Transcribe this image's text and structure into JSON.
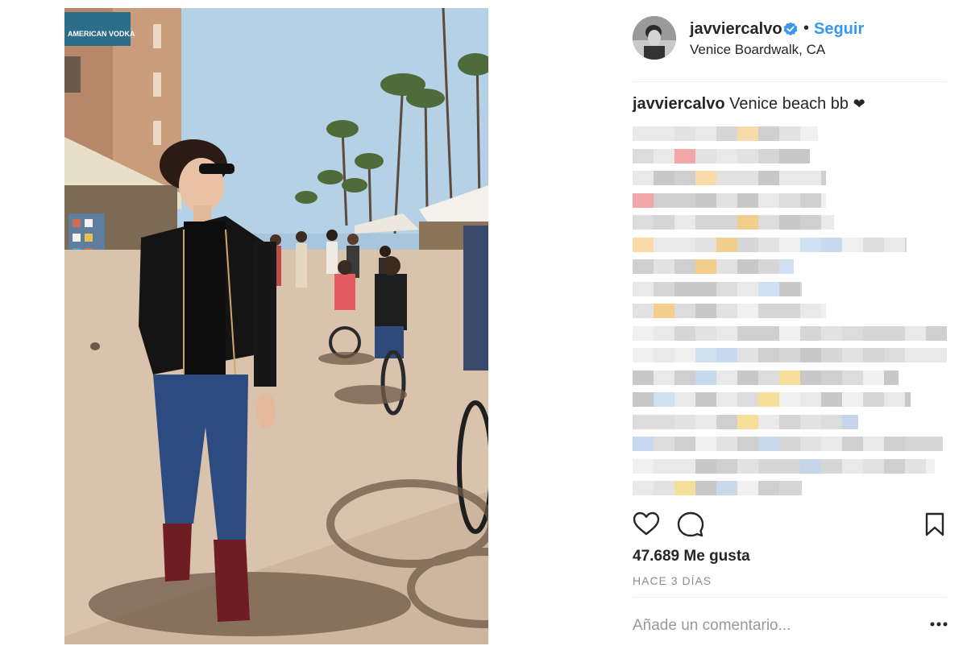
{
  "post": {
    "username": "javviercalvo",
    "follow_label": "Seguir",
    "separator": "•",
    "location": "Venice Boardwalk, CA",
    "caption_user": "javviercalvo",
    "caption_text": "Venice beach bb",
    "caption_emoji": "❤",
    "likes_text": "47.689 Me gusta",
    "time_text": "HACE 3 DÍAS",
    "comment_placeholder": "Añade un comentario..."
  },
  "photo": {
    "sign_text": "AMERICAN VODKA"
  },
  "icons": {
    "verified": "verified-badge-icon",
    "like": "heart-icon",
    "comment": "comment-bubble-icon",
    "save": "bookmark-icon",
    "more": "more-options-icon"
  },
  "colors": {
    "accent": "#3897f0",
    "text": "#262626",
    "muted": "#8e8e8e"
  }
}
